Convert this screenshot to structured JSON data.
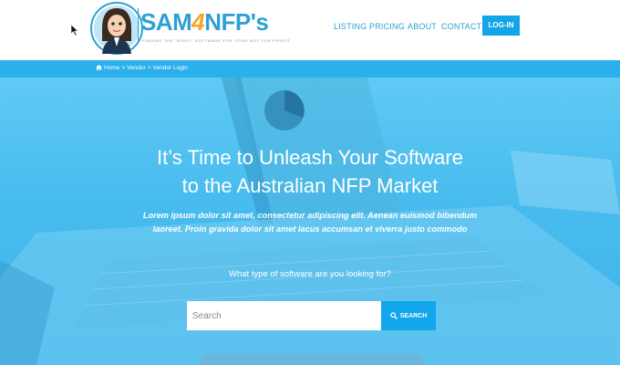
{
  "brand": {
    "name_prefix": "SAM",
    "name_four": "4",
    "name_suffix": "NFP's",
    "tagline": "FINDING THE 'RIGHT' SOFTWARE FOR YOUR NOT FOR PROFIT"
  },
  "nav": {
    "items": [
      "LISTING",
      "PRICING",
      "ABOUT",
      "CONTACT"
    ],
    "login_label": "LOG-IN"
  },
  "breadcrumb": {
    "items": [
      "Home",
      "Vendor",
      "Vendor Login"
    ],
    "separator": ">"
  },
  "hero": {
    "title_line1": "It’s Time to Unleash Your Software",
    "title_line2": "to the Australian NFP Market",
    "subtitle": "Lorem ipsum dolor sit amet, consectetur adipiscing elit. Aenean euismod bibendum laoreet. Proin gravida dolor sit amet lacus accumsan et viverra justo commodo",
    "question": "What type of software are you looking for?"
  },
  "search": {
    "placeholder": "Search",
    "button_label": "SEARCH"
  },
  "colors": {
    "accent": "#13a4e9",
    "breadcrumb_bar": "#2bb0ec",
    "brand_text": "#2fa0d6",
    "brand_four": "#f5a623"
  },
  "icons": {
    "breadcrumb_home": "home-icon",
    "search_button": "search-icon"
  }
}
